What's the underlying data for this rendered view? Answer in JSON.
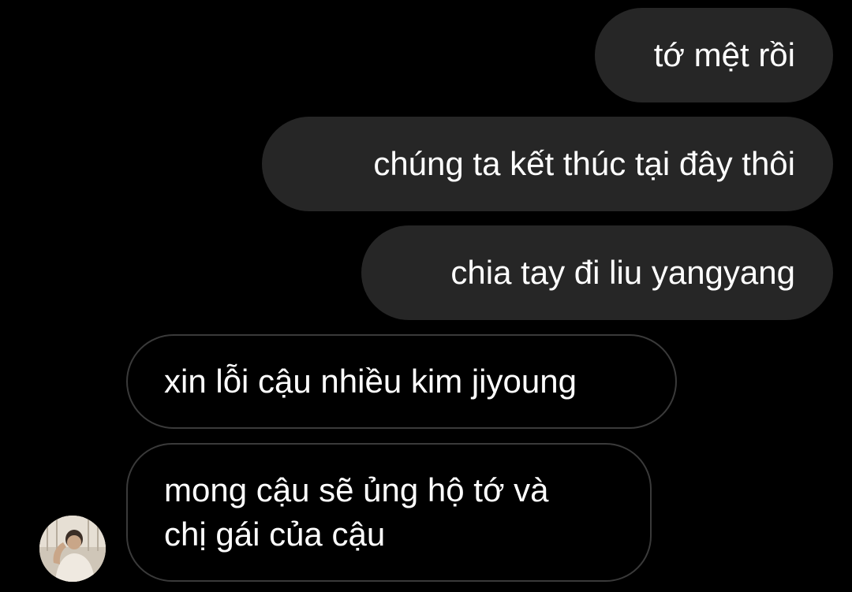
{
  "conversation": {
    "messages": [
      {
        "direction": "sent",
        "text": "tớ mệt rồi"
      },
      {
        "direction": "sent",
        "text": "chúng ta kết thúc tại đây thôi"
      },
      {
        "direction": "sent",
        "text": "chia tay đi liu yangyang"
      },
      {
        "direction": "received",
        "text": "xin lỗi cậu nhiều kim jiyoung"
      },
      {
        "direction": "received",
        "lines": [
          "mong cậu sẽ ủng hộ tớ và",
          "chị gái của cậu"
        ]
      }
    ],
    "avatar": "contact-avatar-photo"
  },
  "colors": {
    "background": "#000000",
    "sent_bubble": "#262626",
    "received_border": "#3a3a3a",
    "text": "#ffffff"
  }
}
